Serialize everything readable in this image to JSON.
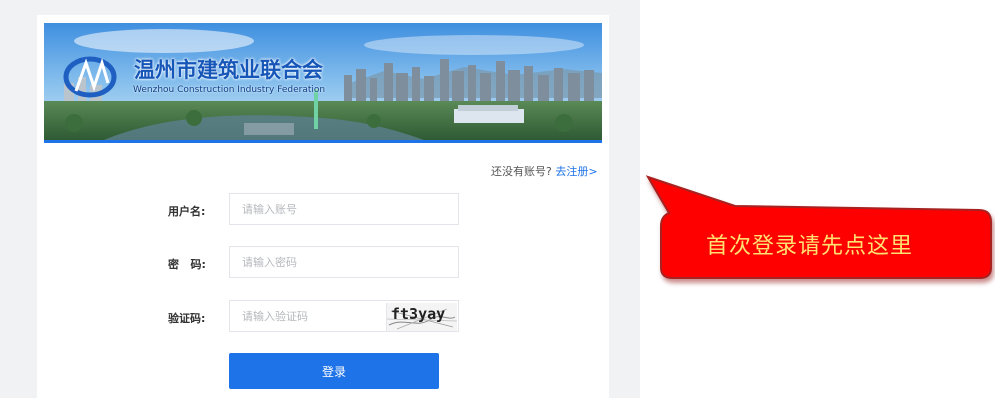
{
  "banner": {
    "title": "温州市建筑业联合会",
    "subtitle": "Wenzhou Construction Industry Federation"
  },
  "register": {
    "prompt": "还没有账号?",
    "link": "去注册>"
  },
  "form": {
    "username_label": "用户名:",
    "username_placeholder": "请输入账号",
    "password_label": "密   码:",
    "password_placeholder": "请输入密码",
    "captcha_label": "验证码:",
    "captcha_placeholder": "请输入验证码",
    "captcha_value": "ft3yay",
    "login_label": "登录"
  },
  "callout": {
    "text": "首次登录请先点这里",
    "fill": "#ff0000",
    "text_color": "#ffe070"
  },
  "colors": {
    "accent": "#1e73e8"
  }
}
